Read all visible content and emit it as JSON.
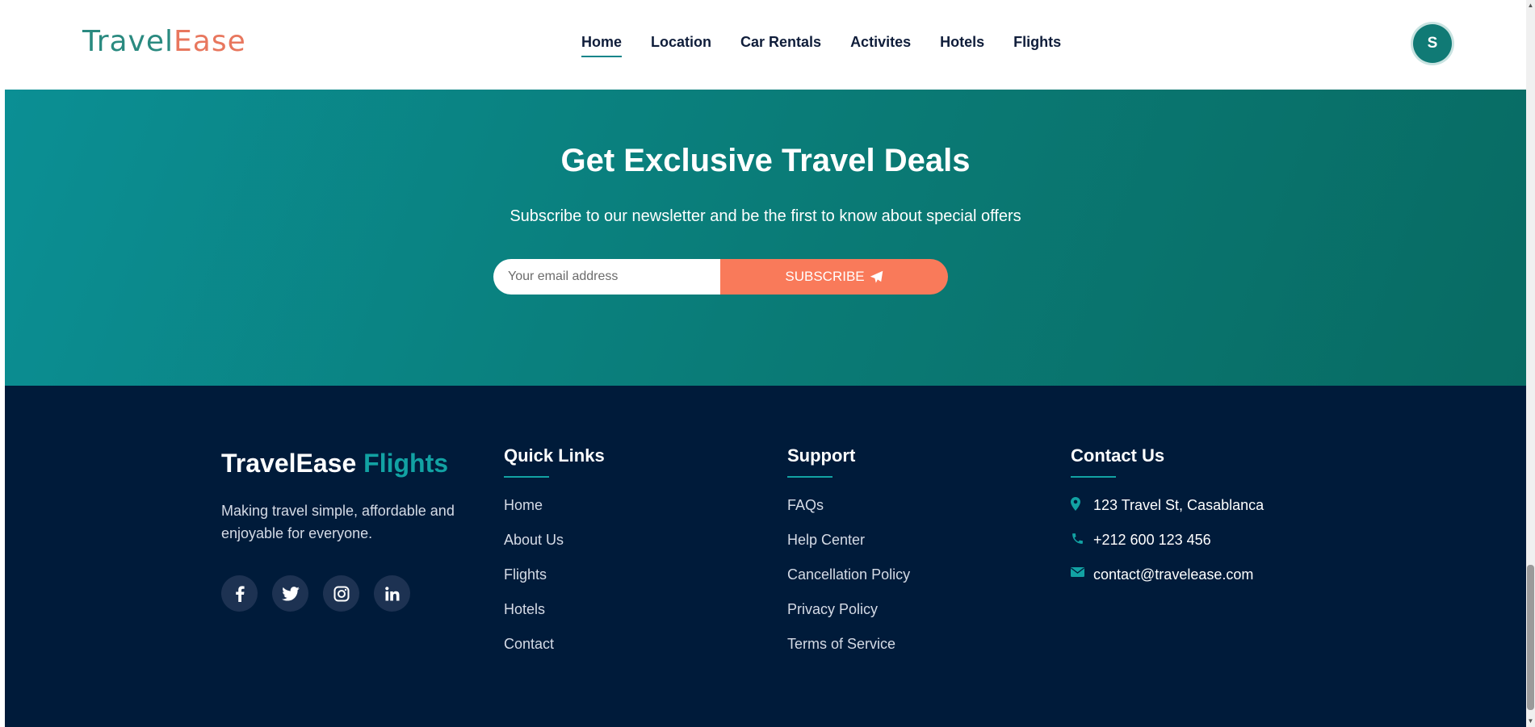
{
  "header": {
    "logo": {
      "part1": "Travel",
      "part2": "Ease"
    },
    "nav": [
      {
        "label": "Home",
        "active": true
      },
      {
        "label": "Location"
      },
      {
        "label": "Car Rentals"
      },
      {
        "label": "Activites"
      },
      {
        "label": "Hotels"
      },
      {
        "label": "Flights"
      }
    ],
    "avatar_initial": "S"
  },
  "newsletter": {
    "title": "Get Exclusive Travel Deals",
    "subtitle": "Subscribe to our newsletter and be the first to know about special offers",
    "email_placeholder": "Your email address",
    "button_label": "SUBSCRIBE"
  },
  "footer": {
    "brand": {
      "part1": "TravelEase",
      "part2": "Flights"
    },
    "about": "Making travel simple, affordable and enjoyable for everyone.",
    "socials": [
      "facebook-icon",
      "twitter-icon",
      "instagram-icon",
      "linkedin-icon"
    ],
    "quick_links": {
      "title": "Quick Links",
      "items": [
        "Home",
        "About Us",
        "Flights",
        "Hotels",
        "Contact"
      ]
    },
    "support": {
      "title": "Support",
      "items": [
        "FAQs",
        "Help Center",
        "Cancellation Policy",
        "Privacy Policy",
        "Terms of Service"
      ]
    },
    "contact": {
      "title": "Contact Us",
      "address": "123 Travel St, Casablanca",
      "phone": "+212 600 123 456",
      "email": "contact@travelease.com"
    }
  },
  "colors": {
    "teal": "#11858a",
    "coral": "#f97a5a",
    "navy": "#001b3a"
  }
}
